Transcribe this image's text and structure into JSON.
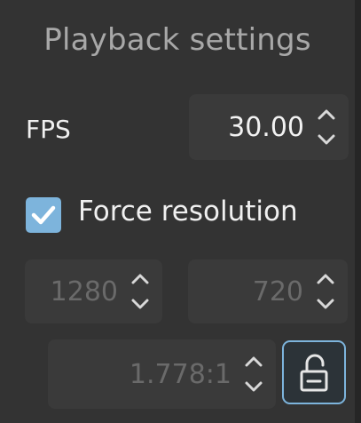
{
  "panel": {
    "title": "Playback settings"
  },
  "fps": {
    "label": "FPS",
    "value": "30.00"
  },
  "force_resolution": {
    "label": "Force resolution",
    "checked": true
  },
  "resolution": {
    "width": "1280",
    "height": "720",
    "aspect_ratio": "1.778:1",
    "lock_icon": "unlocked-padlock-icon"
  },
  "colors": {
    "panel_background": "#333333",
    "accent": "#7db4dc",
    "text": "#f0f0f0",
    "disabled_text": "#6a6a6a"
  }
}
